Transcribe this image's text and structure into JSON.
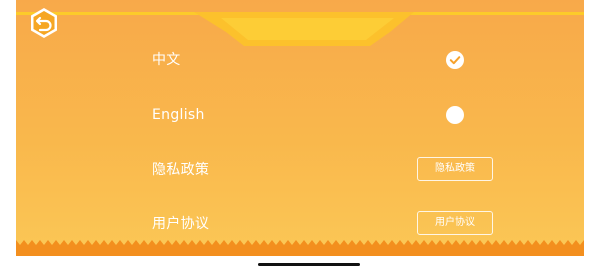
{
  "settings": {
    "rows": [
      {
        "label": "中文",
        "selected": true
      },
      {
        "label": "English",
        "selected": false
      },
      {
        "label": "隐私政策",
        "button_label": "隐私政策"
      },
      {
        "label": "用户协议",
        "button_label": "用户协议"
      }
    ]
  },
  "icons": {
    "back": "back-arrow-icon",
    "check": "checkmark-icon"
  },
  "colors": {
    "background_top": "#f8a94a",
    "background_bottom": "#fbc756",
    "accent_yellow": "#fccb2a",
    "bottom_strip": "#f38f1e",
    "text": "#ffffff"
  }
}
